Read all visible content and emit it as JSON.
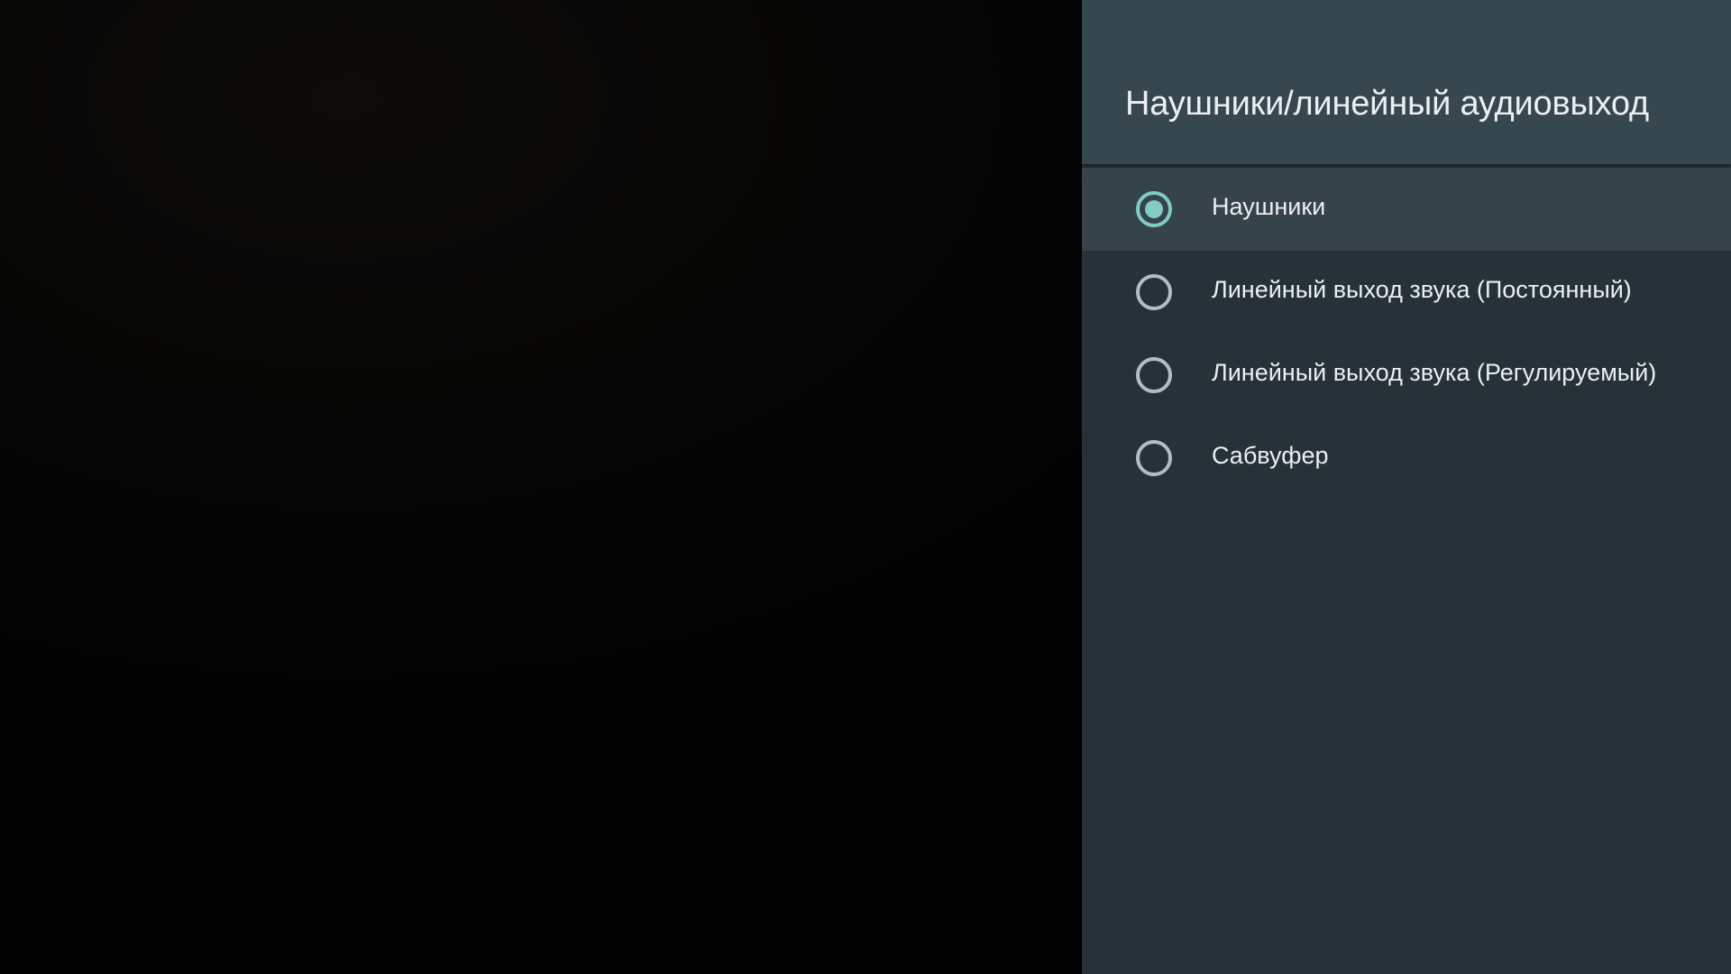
{
  "panel": {
    "title": "Наушники/линейный аудиовыход"
  },
  "options": [
    {
      "label": "Наушники",
      "checked": true,
      "focused": true
    },
    {
      "label": "Линейный выход звука (Постоянный)",
      "checked": false,
      "focused": false
    },
    {
      "label": "Линейный выход звука (Регулируемый)",
      "checked": false,
      "focused": false
    },
    {
      "label": "Сабвуфер",
      "checked": false,
      "focused": false
    }
  ],
  "colors": {
    "panel_background": "#263238",
    "header_background": "#37474f",
    "focused_row": "#37434a",
    "radio_accent": "#80cbc4",
    "radio_unchecked": "#b0bec5",
    "text": "#eceff1"
  },
  "icons": {
    "radio_checked": "radio-checked-icon",
    "radio_unchecked": "radio-unchecked-icon"
  }
}
